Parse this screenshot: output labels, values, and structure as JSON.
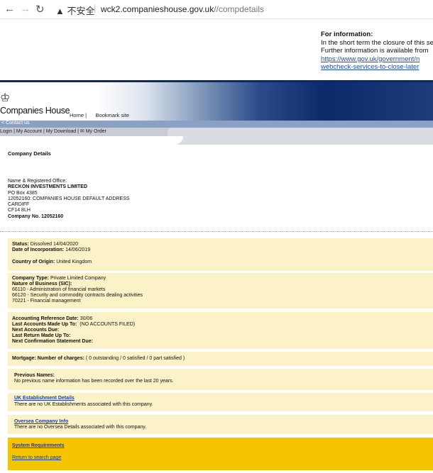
{
  "browser": {
    "security_warning": "▲ 不安全",
    "url_domain": "wck2.companieshouse.gov.uk",
    "url_path": "//compdetails"
  },
  "info": {
    "heading": "For information:",
    "line1": "In the short term the closure of this se",
    "line2": "Further information is available from",
    "link1": "https://www.gov.uk/government/n",
    "link2": "webcheck-services-to-close-later"
  },
  "header": {
    "title": "Companies House",
    "home": "Home |",
    "bookmark": "Bookmark site",
    "contact": "< Contact us"
  },
  "menu": {
    "login": "Login",
    "account": "My Account",
    "download": "My Download",
    "order": "✉ My Order"
  },
  "company": {
    "section_title": "Company Details",
    "name_label": "Name & Registered Office:",
    "name": "RECKON INVESTMENTS LIMITED",
    "addr1": "PO Box 4385",
    "addr2": "12052160: COMPANIES HOUSE DEFAULT ADDRESS",
    "addr3": "CARDIFF",
    "addr4": "CF14 8LH",
    "number": "Company No. 12052160"
  },
  "status": {
    "status_label": "Status:",
    "status_value": "Dissolved 14/04/2020",
    "inc_label": "Date of Incorporation:",
    "inc_value": "14/06/2019",
    "origin_label": "Country of Origin:",
    "origin_value": "United Kingdom"
  },
  "type": {
    "type_label": "Company Type:",
    "type_value": "Private Limited Company",
    "sic_label": "Nature of Business (SIC):",
    "sic": [
      "66110 - Administration of financial markets",
      "66120 - Security and commodity contracts dealing activities",
      "70221 - Financial management"
    ]
  },
  "accounts": {
    "ard_label": "Accounting Reference Date:",
    "ard_value": "30/06",
    "last_acc_label": "Last Accounts Made Up To:",
    "last_acc_value": "(NO ACCOUNTS FILED)",
    "next_acc_label": "Next Accounts Due:",
    "last_ret_label": "Last Return Made Up To:",
    "next_conf_label": "Next Confirmation Statement Due:"
  },
  "mortgage": {
    "label": "Mortgage:",
    "charges_label": "Number of charges:",
    "charges_value": "( 0 outstanding / 0 satisfied / 0 part satisfied )"
  },
  "previous": {
    "label": "Previous Names:",
    "text": "No previous name information has been recorded over the last 20 years."
  },
  "uk_est": {
    "link": "UK Establishment Details",
    "text": "There are no UK Establishments associated with this company."
  },
  "oversea": {
    "link": "Oversea Company Info",
    "text": "There are no Oversea Details associated with this company."
  },
  "footer": {
    "system": "System Requirements",
    "return": "Return to search page"
  }
}
